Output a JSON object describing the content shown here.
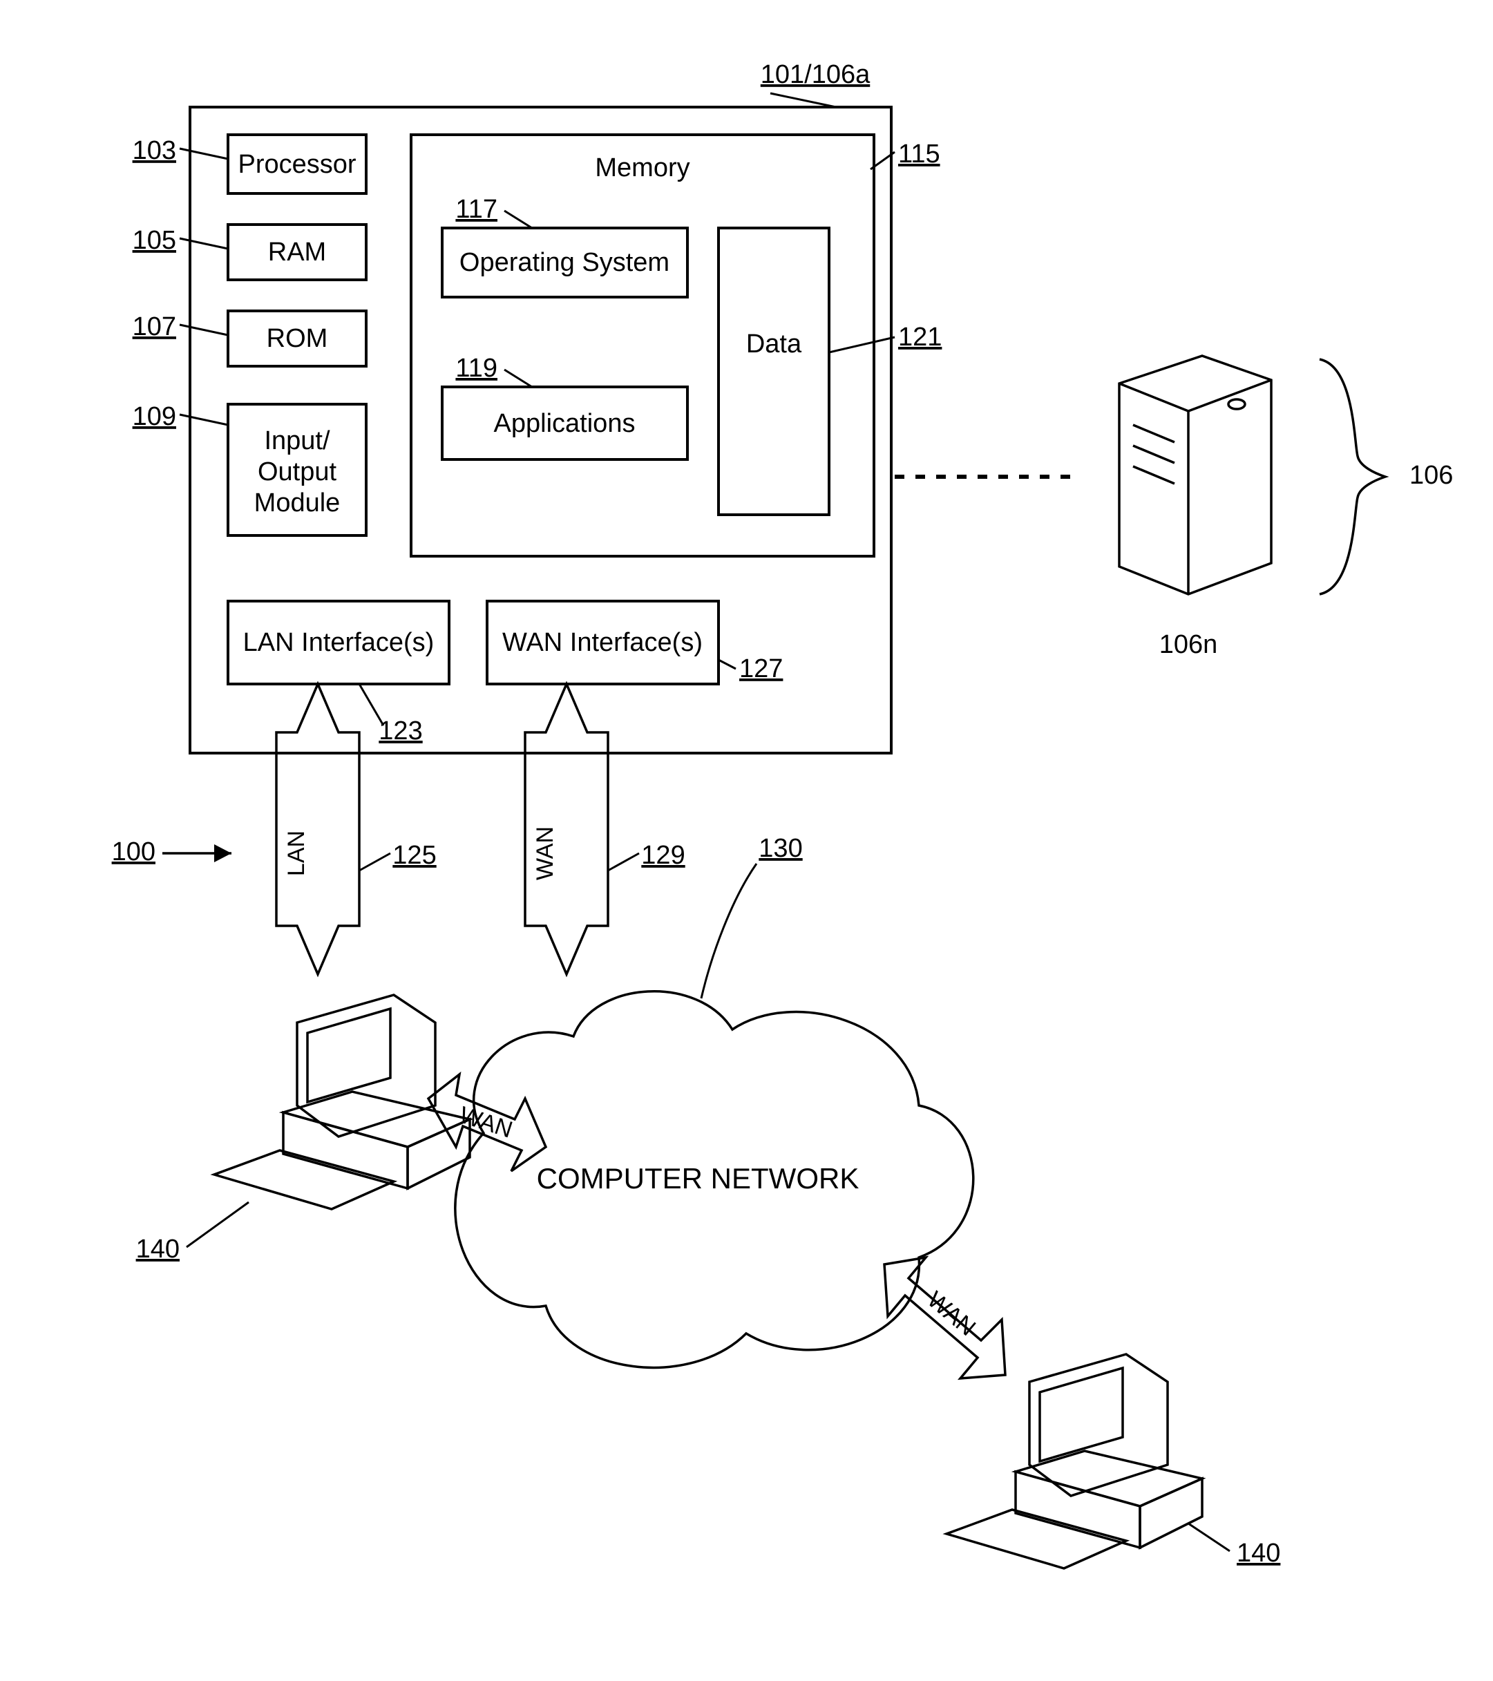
{
  "title_ref": "101/106a",
  "refs": {
    "r100": "100",
    "r103": "103",
    "r105": "105",
    "r106": "106",
    "r106n": "106n",
    "r107": "107",
    "r109": "109",
    "r115": "115",
    "r117": "117",
    "r119": "119",
    "r121": "121",
    "r123": "123",
    "r125": "125",
    "r127": "127",
    "r129": "129",
    "r130": "130",
    "r140a": "140",
    "r140b": "140"
  },
  "boxes": {
    "processor": "Processor",
    "ram": "RAM",
    "rom": "ROM",
    "iomod1": "Input/",
    "iomod2": "Output",
    "iomod3": "Module",
    "memory": "Memory",
    "os": "Operating System",
    "apps": "Applications",
    "data": "Data",
    "lanif": "LAN Interface(s)",
    "wanif": "WAN Interface(s)"
  },
  "links": {
    "lan": "LAN",
    "wan": "WAN"
  },
  "cloud": "COMPUTER NETWORK"
}
